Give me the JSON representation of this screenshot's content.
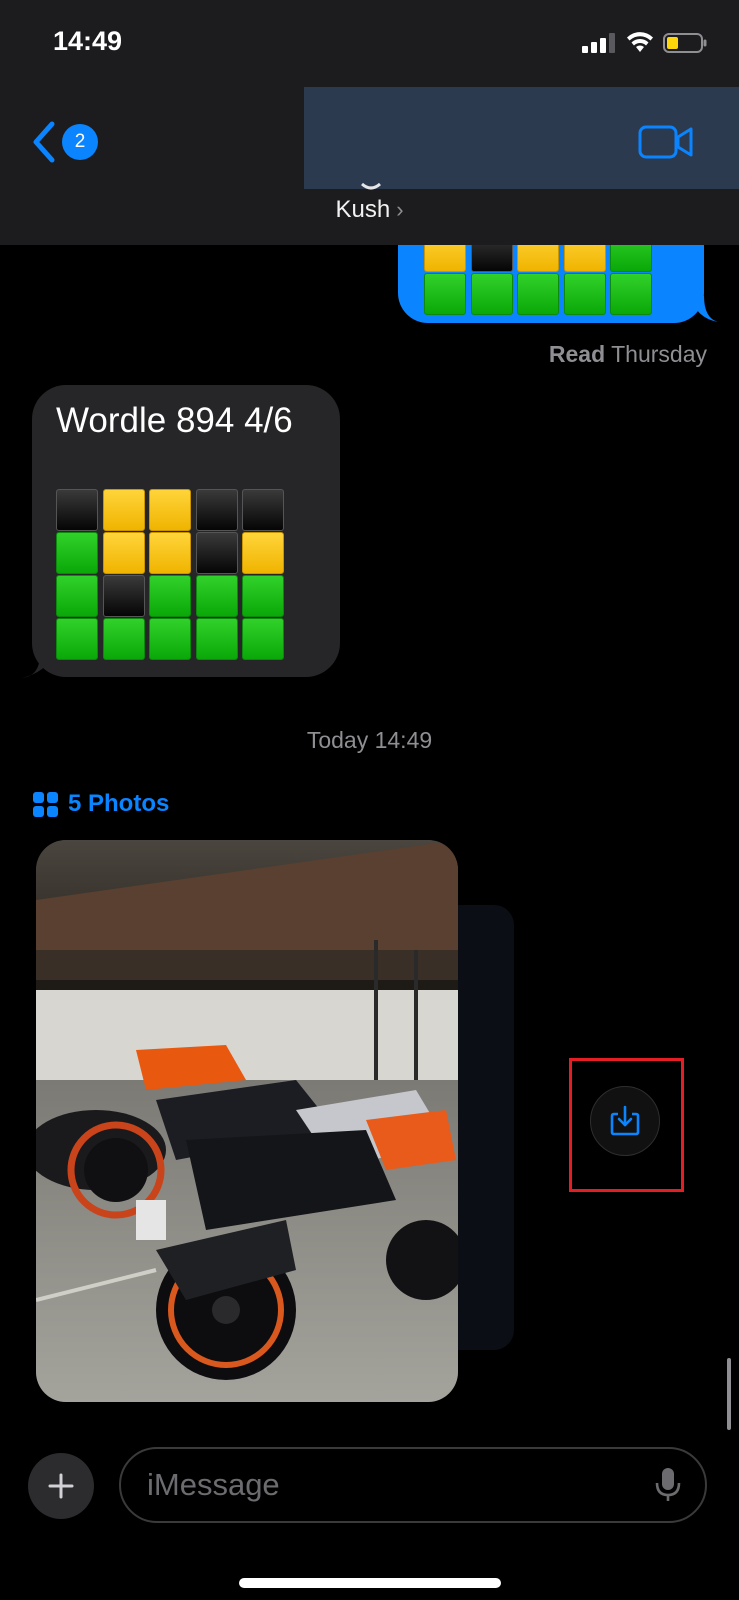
{
  "status_bar": {
    "time": "14:49"
  },
  "header": {
    "back_badge": "2",
    "contact_name": "Kush",
    "contact_chevron": "›",
    "icons": {
      "back": "chevron-left-icon",
      "video": "video-camera-icon"
    }
  },
  "sent_message": {
    "visible_rows": [
      [
        "y",
        "b",
        "y",
        "y",
        "g"
      ],
      [
        "g",
        "g",
        "g",
        "g",
        "g"
      ]
    ],
    "read_label": "Read",
    "read_time": "Thursday"
  },
  "received_message": {
    "title": "Wordle 894 4/6",
    "rows": [
      [
        "b",
        "y",
        "y",
        "b",
        "b"
      ],
      [
        "g",
        "y",
        "y",
        "b",
        "y"
      ],
      [
        "g",
        "b",
        "g",
        "g",
        "g"
      ],
      [
        "g",
        "g",
        "g",
        "g",
        "g"
      ]
    ]
  },
  "timestamp": "Today 14:49",
  "photos": {
    "label": "5 Photos",
    "count": 5
  },
  "save_button": {
    "icon": "save-to-library-icon"
  },
  "composer": {
    "placeholder": "iMessage",
    "plus_icon": "plus-icon",
    "mic_icon": "microphone-icon"
  },
  "colors": {
    "accent": "#0a84ff",
    "wordle_green": "#1ec21a",
    "wordle_yellow": "#f5c518",
    "highlight_red": "#e41e25",
    "received_bubble": "#262628"
  }
}
